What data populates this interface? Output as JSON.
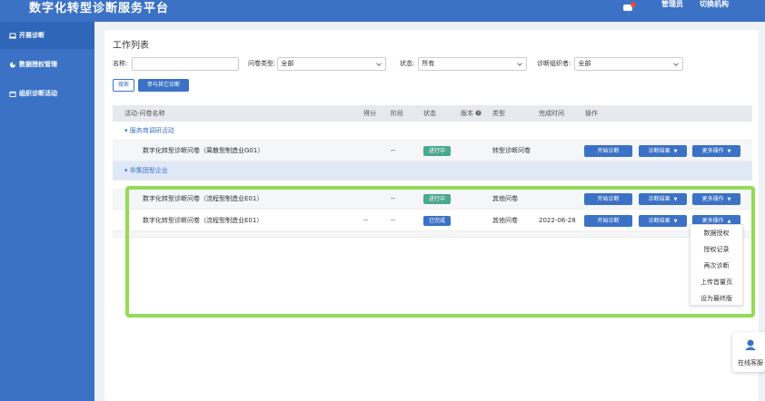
{
  "header": {
    "title": "数字化转型诊断服务平台",
    "admin_label": "管理员",
    "switch_label": "切换机构"
  },
  "sidebar": {
    "items": [
      {
        "label": "开展诊断",
        "icon": "laptop-icon"
      },
      {
        "label": "数据授权管理",
        "icon": "pie-chart-icon"
      },
      {
        "label": "组织诊断活动",
        "icon": "calendar-icon"
      }
    ]
  },
  "main": {
    "title": "工作列表",
    "filters": {
      "name_label": "名称:",
      "name_value": "",
      "type_label": "问卷类型:",
      "type_value": "全部",
      "status_label": "状态:",
      "status_value": "所有",
      "org_label": "诊断组织者:",
      "org_value": "全部"
    },
    "buttons": {
      "search": "搜索",
      "join": "参与其它诊断"
    },
    "table": {
      "headers": [
        "活动-问卷名称",
        "得分",
        "阶段",
        "状态",
        "版本",
        "类型",
        "完成时间",
        "操作"
      ],
      "groups": [
        {
          "name": "服务商调研活动",
          "rows": [
            {
              "name": "数字化转型诊断问卷（离散型制造业G01）",
              "score": "",
              "stage": "--",
              "status": "进行中",
              "status_kind": "doing",
              "version": "",
              "type": "转型诊断问卷",
              "time": ""
            }
          ]
        },
        {
          "name": "非集团型企业",
          "rows": [
            {
              "name": "数字化转型诊断问卷（流程型制造业E01）",
              "score": "",
              "stage": "--",
              "status": "进行中",
              "status_kind": "doing",
              "version": "",
              "type": "其他问卷",
              "time": ""
            },
            {
              "name": "数字化转型诊断问卷（流程型制造业E01）",
              "score": "--",
              "stage": "--",
              "status": "已完成",
              "status_kind": "done",
              "version": "",
              "type": "其他问卷",
              "time": "2022-06-28"
            }
          ]
        }
      ],
      "actions": {
        "start": "开始诊断",
        "result": "诊断结果",
        "more": "更多操作"
      }
    },
    "more_menu": [
      "数据授权",
      "授权记录",
      "再次诊断",
      "上传首量页",
      "设为最终版"
    ]
  },
  "customer_service": {
    "label": "在线客服"
  },
  "colors": {
    "primary": "#3b72c6",
    "doing": "#4ca890",
    "highlight": "#93db56"
  }
}
